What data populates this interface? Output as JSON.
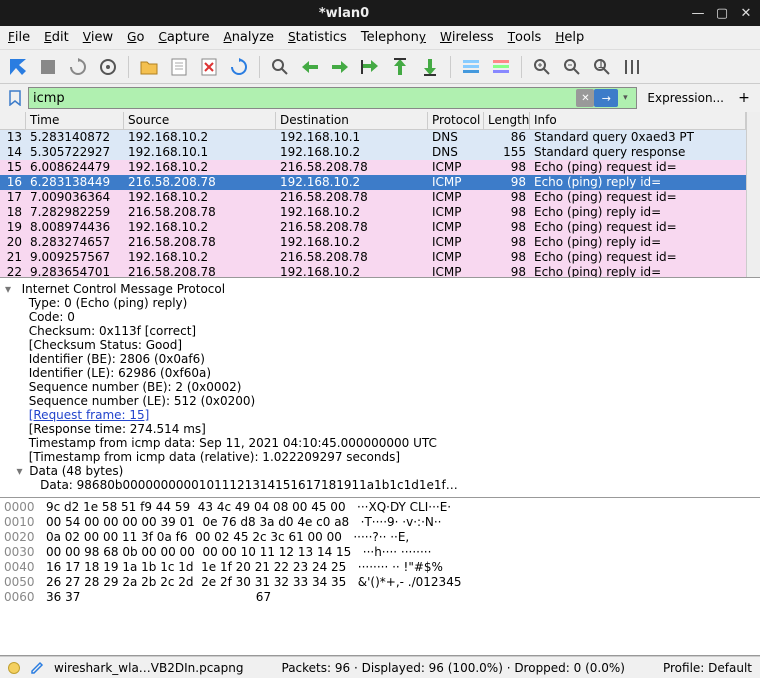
{
  "titlebar": {
    "title": "*wlan0"
  },
  "menu": [
    "File",
    "Edit",
    "View",
    "Go",
    "Capture",
    "Analyze",
    "Statistics",
    "Telephony",
    "Wireless",
    "Tools",
    "Help"
  ],
  "filter": {
    "value": "icmp",
    "expression_label": "Expression...",
    "plus": "+"
  },
  "columns": [
    "",
    "Time",
    "Source",
    "Destination",
    "Protocol",
    "Length",
    "Info"
  ],
  "rows": [
    {
      "no": "13",
      "time": "5.283140872",
      "src": "192.168.10.2",
      "dst": "192.168.10.1",
      "proto": "DNS",
      "len": "86",
      "info": "Standard query 0xaed3 PT",
      "cls": "r-dns"
    },
    {
      "no": "14",
      "time": "5.305722927",
      "src": "192.168.10.1",
      "dst": "192.168.10.2",
      "proto": "DNS",
      "len": "155",
      "info": "Standard query response",
      "cls": "r-dns"
    },
    {
      "no": "15",
      "time": "6.008624479",
      "src": "192.168.10.2",
      "dst": "216.58.208.78",
      "proto": "ICMP",
      "len": "98",
      "info": "Echo (ping) request  id=",
      "cls": "r-icmp"
    },
    {
      "no": "16",
      "time": "6.283138449",
      "src": "216.58.208.78",
      "dst": "192.168.10.2",
      "proto": "ICMP",
      "len": "98",
      "info": "Echo (ping) reply    id=",
      "cls": "r-sel"
    },
    {
      "no": "17",
      "time": "7.009036364",
      "src": "192.168.10.2",
      "dst": "216.58.208.78",
      "proto": "ICMP",
      "len": "98",
      "info": "Echo (ping) request  id=",
      "cls": "r-icmp"
    },
    {
      "no": "18",
      "time": "7.282982259",
      "src": "216.58.208.78",
      "dst": "192.168.10.2",
      "proto": "ICMP",
      "len": "98",
      "info": "Echo (ping) reply    id=",
      "cls": "r-icmp"
    },
    {
      "no": "19",
      "time": "8.008974436",
      "src": "192.168.10.2",
      "dst": "216.58.208.78",
      "proto": "ICMP",
      "len": "98",
      "info": "Echo (ping) request  id=",
      "cls": "r-icmp"
    },
    {
      "no": "20",
      "time": "8.283274657",
      "src": "216.58.208.78",
      "dst": "192.168.10.2",
      "proto": "ICMP",
      "len": "98",
      "info": "Echo (ping) reply    id=",
      "cls": "r-icmp"
    },
    {
      "no": "21",
      "time": "9.009257567",
      "src": "192.168.10.2",
      "dst": "216.58.208.78",
      "proto": "ICMP",
      "len": "98",
      "info": "Echo (ping) request  id=",
      "cls": "r-icmp"
    },
    {
      "no": "22",
      "time": "9.283654701",
      "src": "216.58.208.78",
      "dst": "192.168.10.2",
      "proto": "ICMP",
      "len": "98",
      "info": "Echo (ping) reply    id=",
      "cls": "r-icmp"
    }
  ],
  "details": {
    "l0": "Internet Control Message Protocol",
    "l1": "Type: 0 (Echo (ping) reply)",
    "l2": "Code: 0",
    "l3": "Checksum: 0x113f [correct]",
    "l4": "[Checksum Status: Good]",
    "l5": "Identifier (BE): 2806 (0x0af6)",
    "l6": "Identifier (LE): 62986 (0xf60a)",
    "l7": "Sequence number (BE): 2 (0x0002)",
    "l8": "Sequence number (LE): 512 (0x0200)",
    "l9": "[Request frame: 15]",
    "l10": "[Response time: 274.514 ms]",
    "l11": "Timestamp from icmp data: Sep 11, 2021 04:10:45.000000000 UTC",
    "l12": "[Timestamp from icmp data (relative): 1.022209297 seconds]",
    "l13": "Data (48 bytes)",
    "l14": "Data: 98680b00000000001011121314151617181911a1b1c1d1e1f…"
  },
  "hex": [
    {
      "off": "0000",
      "h": "9c d2 1e 58 51 f9 44 59  43 4c 49 04 08 00 45 00",
      "a": "···XQ·DY CLI···E·"
    },
    {
      "off": "0010",
      "h": "00 54 00 00 00 00 39 01  0e 76 d8 3a d0 4e c0 a8",
      "a": "·T····9· ·v·:·N··"
    },
    {
      "off": "0020",
      "h": "0a 02 00 00 11 3f 0a f6  00 02 45 2c 3c 61 00 00",
      "a": "·····?·· ··E,<a··"
    },
    {
      "off": "0030",
      "h": "00 00 98 68 0b 00 00 00  00 00 10 11 12 13 14 15",
      "a": "···h···· ········"
    },
    {
      "off": "0040",
      "h": "16 17 18 19 1a 1b 1c 1d  1e 1f 20 21 22 23 24 25",
      "a": "········ ·· !\"#$%"
    },
    {
      "off": "0050",
      "h": "26 27 28 29 2a 2b 2c 2d  2e 2f 30 31 32 33 34 35",
      "a": "&'()*+,- ./012345"
    },
    {
      "off": "0060",
      "h": "36 37                                           ",
      "a": "67"
    }
  ],
  "status": {
    "file": "wireshark_wla…VB2DIn.pcapng",
    "packets": "Packets: 96 · Displayed: 96 (100.0%) · Dropped: 0 (0.0%)",
    "profile": "Profile: Default"
  }
}
